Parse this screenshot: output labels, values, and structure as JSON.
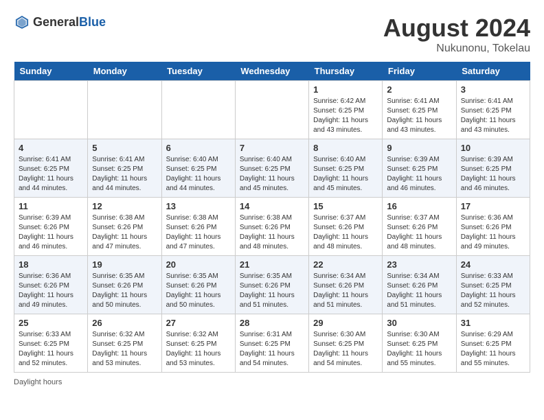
{
  "header": {
    "logo_general": "General",
    "logo_blue": "Blue",
    "month_year": "August 2024",
    "location": "Nukunonu, Tokelau"
  },
  "footer": {
    "daylight_label": "Daylight hours"
  },
  "days_of_week": [
    "Sunday",
    "Monday",
    "Tuesday",
    "Wednesday",
    "Thursday",
    "Friday",
    "Saturday"
  ],
  "weeks": [
    [
      {
        "day": "",
        "info": ""
      },
      {
        "day": "",
        "info": ""
      },
      {
        "day": "",
        "info": ""
      },
      {
        "day": "",
        "info": ""
      },
      {
        "day": "1",
        "info": "Sunrise: 6:42 AM\nSunset: 6:25 PM\nDaylight: 11 hours\nand 43 minutes."
      },
      {
        "day": "2",
        "info": "Sunrise: 6:41 AM\nSunset: 6:25 PM\nDaylight: 11 hours\nand 43 minutes."
      },
      {
        "day": "3",
        "info": "Sunrise: 6:41 AM\nSunset: 6:25 PM\nDaylight: 11 hours\nand 43 minutes."
      }
    ],
    [
      {
        "day": "4",
        "info": "Sunrise: 6:41 AM\nSunset: 6:25 PM\nDaylight: 11 hours\nand 44 minutes."
      },
      {
        "day": "5",
        "info": "Sunrise: 6:41 AM\nSunset: 6:25 PM\nDaylight: 11 hours\nand 44 minutes."
      },
      {
        "day": "6",
        "info": "Sunrise: 6:40 AM\nSunset: 6:25 PM\nDaylight: 11 hours\nand 44 minutes."
      },
      {
        "day": "7",
        "info": "Sunrise: 6:40 AM\nSunset: 6:25 PM\nDaylight: 11 hours\nand 45 minutes."
      },
      {
        "day": "8",
        "info": "Sunrise: 6:40 AM\nSunset: 6:25 PM\nDaylight: 11 hours\nand 45 minutes."
      },
      {
        "day": "9",
        "info": "Sunrise: 6:39 AM\nSunset: 6:25 PM\nDaylight: 11 hours\nand 46 minutes."
      },
      {
        "day": "10",
        "info": "Sunrise: 6:39 AM\nSunset: 6:25 PM\nDaylight: 11 hours\nand 46 minutes."
      }
    ],
    [
      {
        "day": "11",
        "info": "Sunrise: 6:39 AM\nSunset: 6:26 PM\nDaylight: 11 hours\nand 46 minutes."
      },
      {
        "day": "12",
        "info": "Sunrise: 6:38 AM\nSunset: 6:26 PM\nDaylight: 11 hours\nand 47 minutes."
      },
      {
        "day": "13",
        "info": "Sunrise: 6:38 AM\nSunset: 6:26 PM\nDaylight: 11 hours\nand 47 minutes."
      },
      {
        "day": "14",
        "info": "Sunrise: 6:38 AM\nSunset: 6:26 PM\nDaylight: 11 hours\nand 48 minutes."
      },
      {
        "day": "15",
        "info": "Sunrise: 6:37 AM\nSunset: 6:26 PM\nDaylight: 11 hours\nand 48 minutes."
      },
      {
        "day": "16",
        "info": "Sunrise: 6:37 AM\nSunset: 6:26 PM\nDaylight: 11 hours\nand 48 minutes."
      },
      {
        "day": "17",
        "info": "Sunrise: 6:36 AM\nSunset: 6:26 PM\nDaylight: 11 hours\nand 49 minutes."
      }
    ],
    [
      {
        "day": "18",
        "info": "Sunrise: 6:36 AM\nSunset: 6:26 PM\nDaylight: 11 hours\nand 49 minutes."
      },
      {
        "day": "19",
        "info": "Sunrise: 6:35 AM\nSunset: 6:26 PM\nDaylight: 11 hours\nand 50 minutes."
      },
      {
        "day": "20",
        "info": "Sunrise: 6:35 AM\nSunset: 6:26 PM\nDaylight: 11 hours\nand 50 minutes."
      },
      {
        "day": "21",
        "info": "Sunrise: 6:35 AM\nSunset: 6:26 PM\nDaylight: 11 hours\nand 51 minutes."
      },
      {
        "day": "22",
        "info": "Sunrise: 6:34 AM\nSunset: 6:26 PM\nDaylight: 11 hours\nand 51 minutes."
      },
      {
        "day": "23",
        "info": "Sunrise: 6:34 AM\nSunset: 6:26 PM\nDaylight: 11 hours\nand 51 minutes."
      },
      {
        "day": "24",
        "info": "Sunrise: 6:33 AM\nSunset: 6:25 PM\nDaylight: 11 hours\nand 52 minutes."
      }
    ],
    [
      {
        "day": "25",
        "info": "Sunrise: 6:33 AM\nSunset: 6:25 PM\nDaylight: 11 hours\nand 52 minutes."
      },
      {
        "day": "26",
        "info": "Sunrise: 6:32 AM\nSunset: 6:25 PM\nDaylight: 11 hours\nand 53 minutes."
      },
      {
        "day": "27",
        "info": "Sunrise: 6:32 AM\nSunset: 6:25 PM\nDaylight: 11 hours\nand 53 minutes."
      },
      {
        "day": "28",
        "info": "Sunrise: 6:31 AM\nSunset: 6:25 PM\nDaylight: 11 hours\nand 54 minutes."
      },
      {
        "day": "29",
        "info": "Sunrise: 6:30 AM\nSunset: 6:25 PM\nDaylight: 11 hours\nand 54 minutes."
      },
      {
        "day": "30",
        "info": "Sunrise: 6:30 AM\nSunset: 6:25 PM\nDaylight: 11 hours\nand 55 minutes."
      },
      {
        "day": "31",
        "info": "Sunrise: 6:29 AM\nSunset: 6:25 PM\nDaylight: 11 hours\nand 55 minutes."
      }
    ]
  ]
}
